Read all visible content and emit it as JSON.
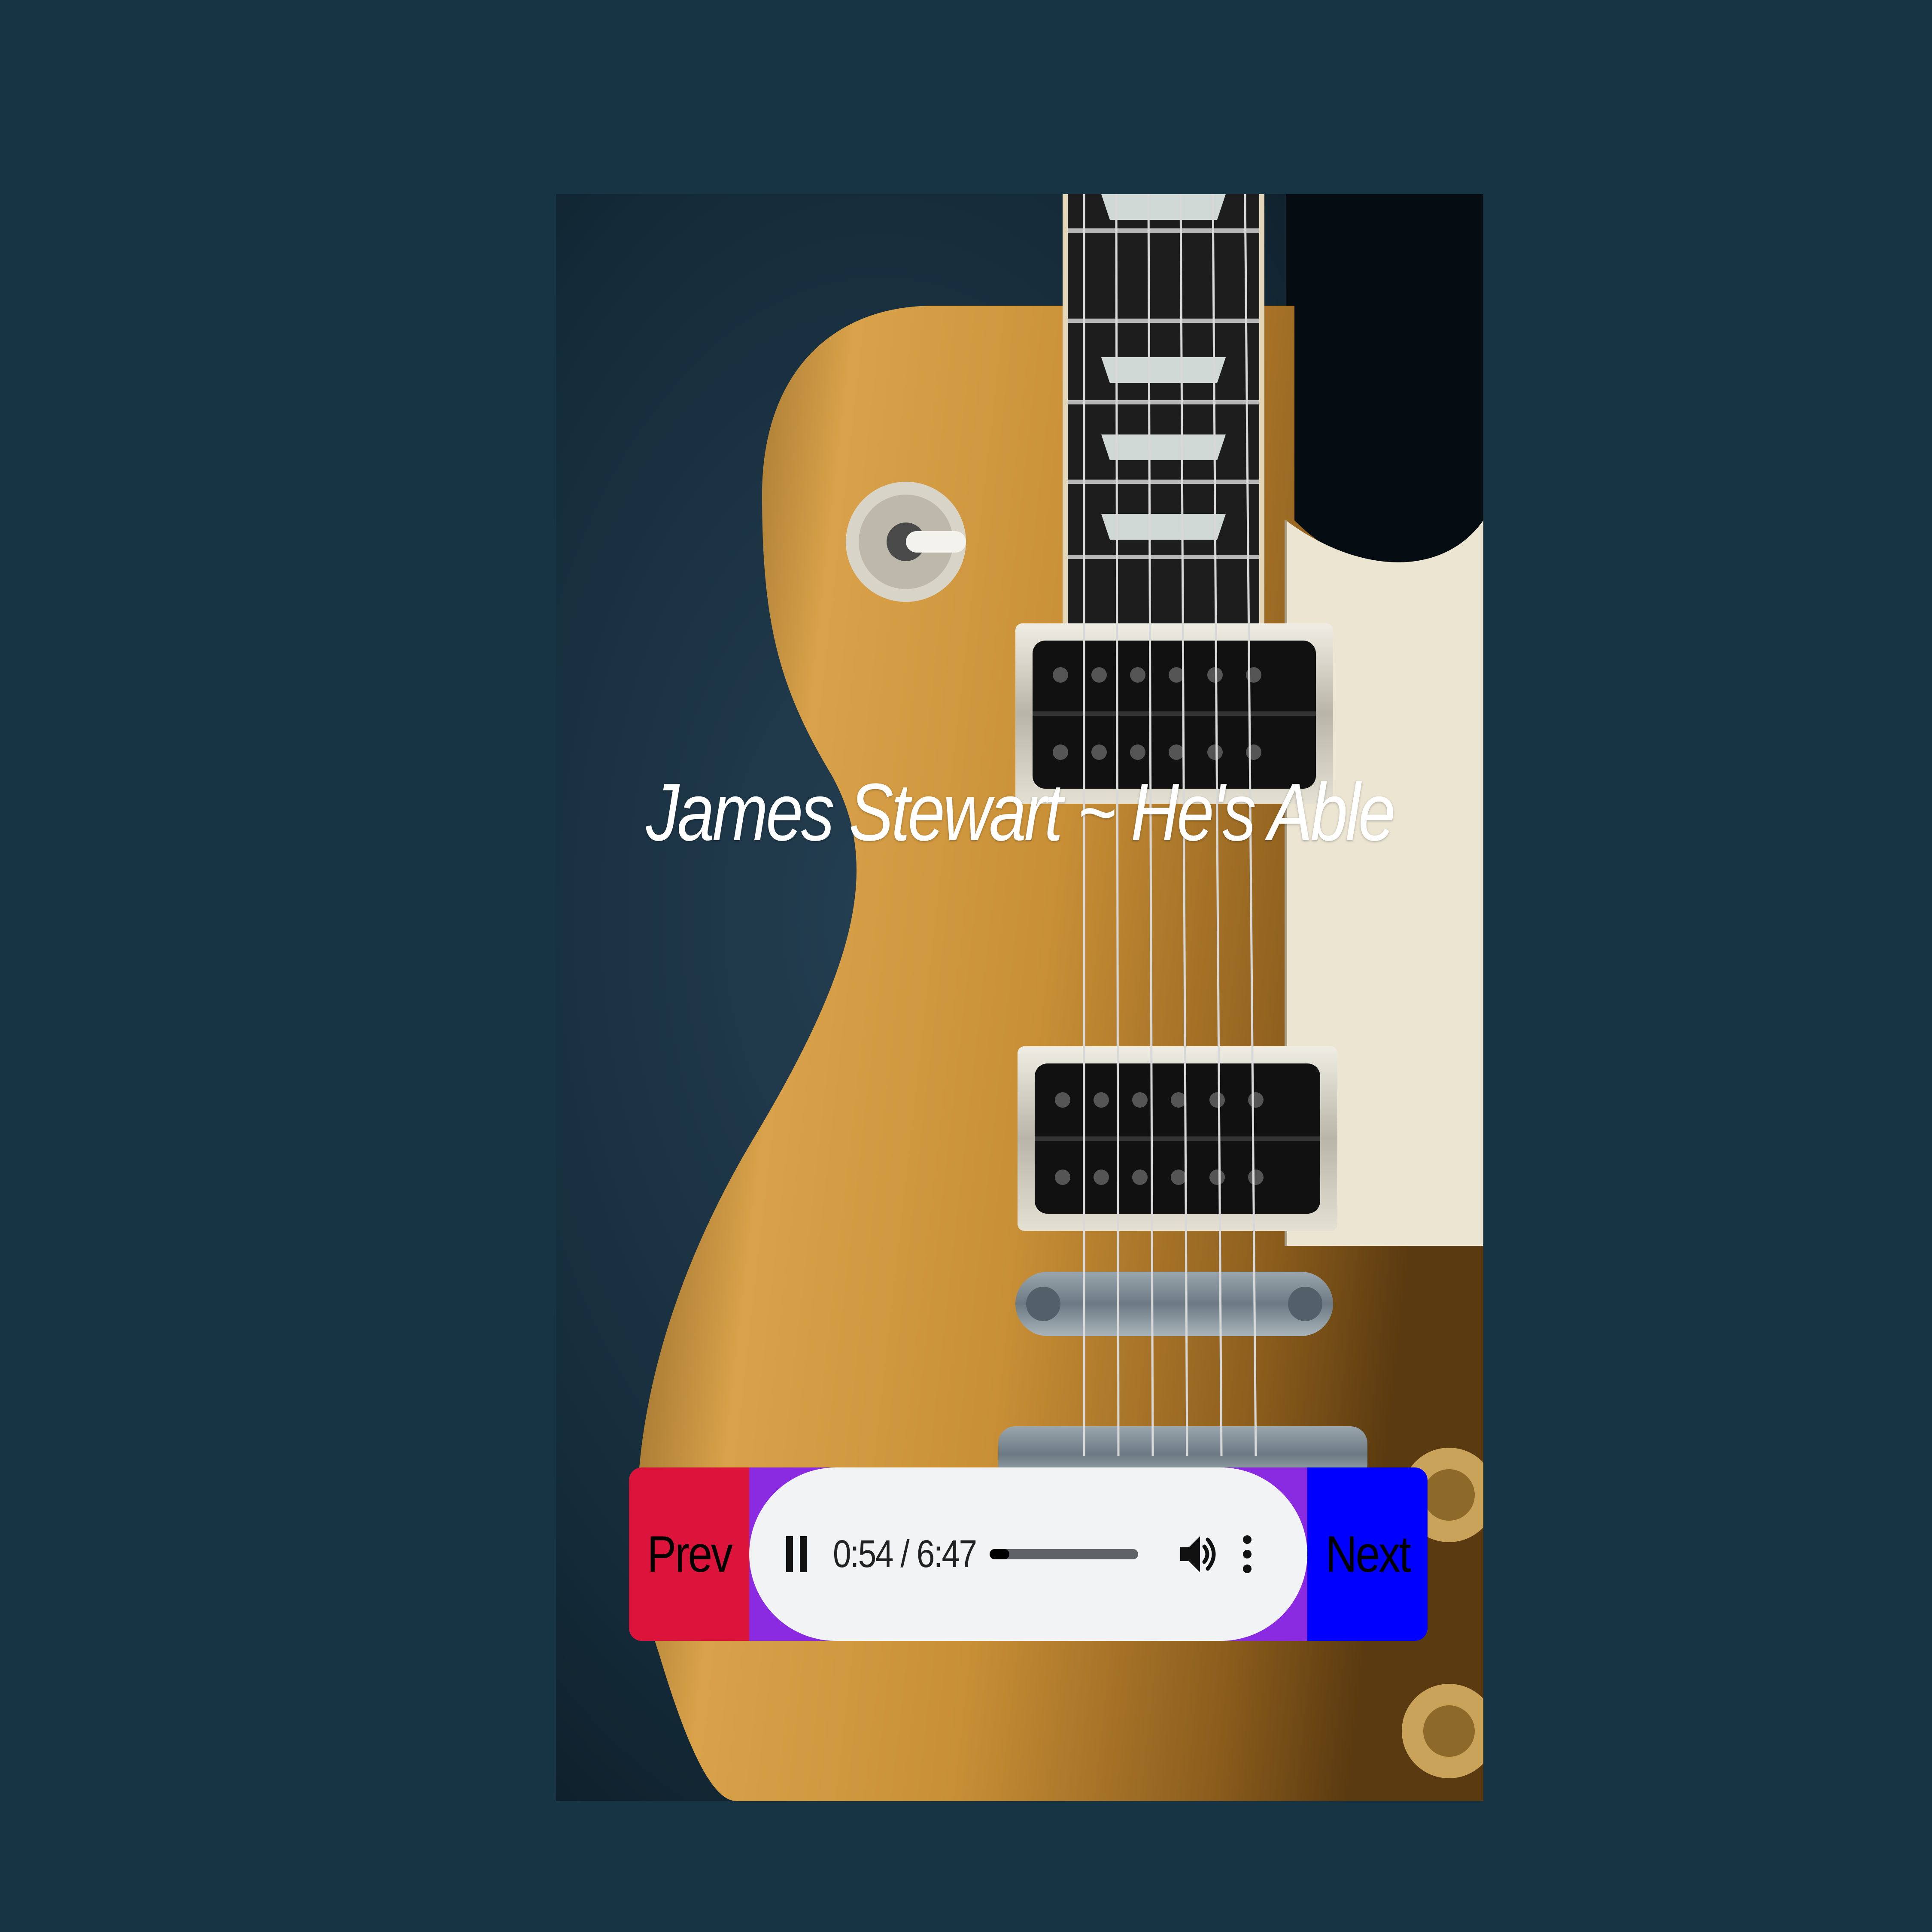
{
  "track": {
    "title": "James Stewart ~ He's Able"
  },
  "controls": {
    "prev_label": "Prev",
    "next_label": "Next"
  },
  "audio": {
    "current_time": "0:54",
    "duration": "6:47",
    "time_text": "0:54 / 6:47",
    "progress": 0.133,
    "state": "playing"
  },
  "colors": {
    "page_background": "#163444",
    "prev_button": "#dc143c",
    "next_button": "#0000ff",
    "audio_frame": "#8a2be2",
    "audio_player": "#f1f3f4"
  },
  "icons": {
    "playback": "pause-icon",
    "volume": "volume-icon",
    "menu": "more-options-icon"
  }
}
